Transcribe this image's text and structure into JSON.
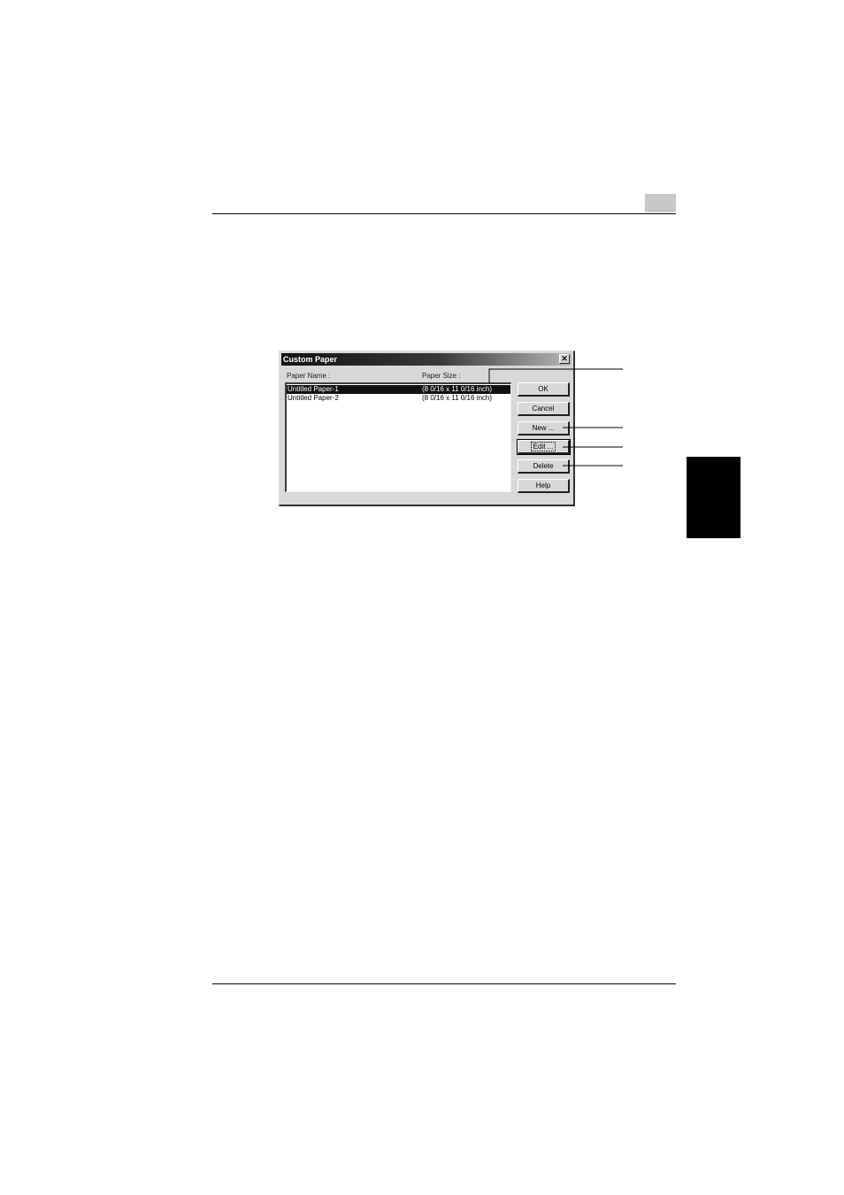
{
  "dialog": {
    "title": "Custom Paper",
    "close_glyph": "✕",
    "columns": {
      "name": "Paper Name :",
      "size": "Paper Size :"
    },
    "rows": [
      {
        "name": "Untitled Paper-1",
        "size": "(8 0/16 x 11 0/16 inch)",
        "selected": true
      },
      {
        "name": "Untitled Paper-2",
        "size": "(8 0/16 x 11 0/16 inch)",
        "selected": false
      }
    ],
    "buttons": {
      "ok": "OK",
      "cancel": "Cancel",
      "new": "New ...",
      "edit": "Edit ...",
      "delete": "Delete",
      "help": "Help"
    }
  },
  "icons": {
    "close": "close-icon"
  }
}
